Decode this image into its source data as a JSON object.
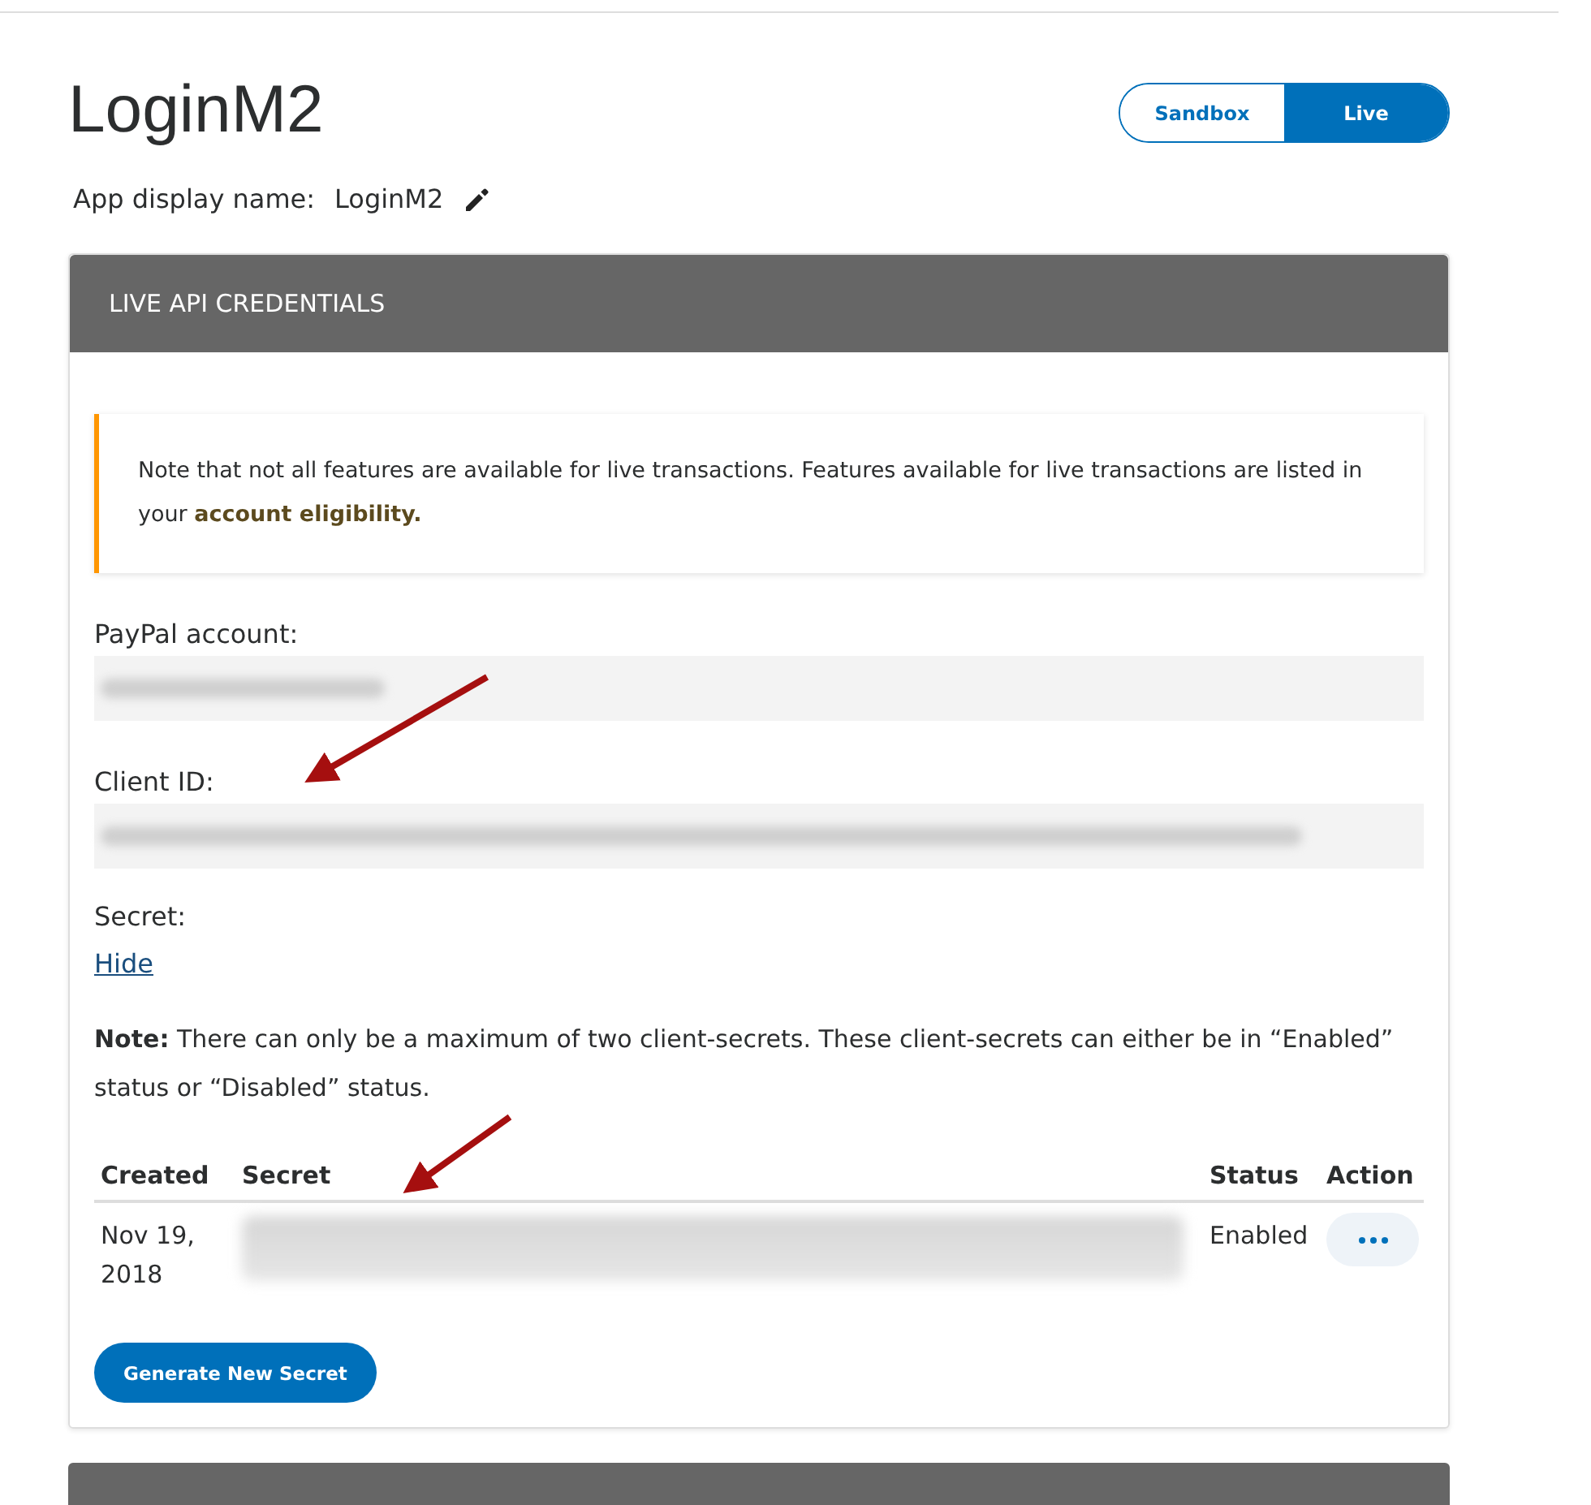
{
  "title": "LoginM2",
  "environment_toggle": [
    {
      "label": "Sandbox",
      "selected": false
    },
    {
      "label": "Live",
      "selected": true
    }
  ],
  "display_name": {
    "label": "App display name:",
    "value": "LoginM2"
  },
  "credentials": {
    "header": "LIVE API CREDENTIALS",
    "notice": {
      "text": "Note that not all features are available for live transactions. Features available for live transactions are listed in your",
      "link": "account eligibility."
    },
    "fields": [
      {
        "label": "PayPal account:",
        "redacted": true
      },
      {
        "label": "Client ID:",
        "redacted": true
      }
    ],
    "secret": {
      "label": "Secret:",
      "toggle_link": "Hide"
    },
    "note": "**Note:** There can only be a maximum of two client-secrets. These client-secrets can either be in “Enabled” status or “Disabled” status.",
    "table": {
      "columns": [
        "Created",
        "Secret",
        "Status",
        "Action"
      ],
      "rows": [
        {
          "created": "Nov 19, 2018",
          "secret_redacted": true,
          "status": "Enabled"
        }
      ]
    },
    "generate_button": "Generate New Secret"
  }
}
